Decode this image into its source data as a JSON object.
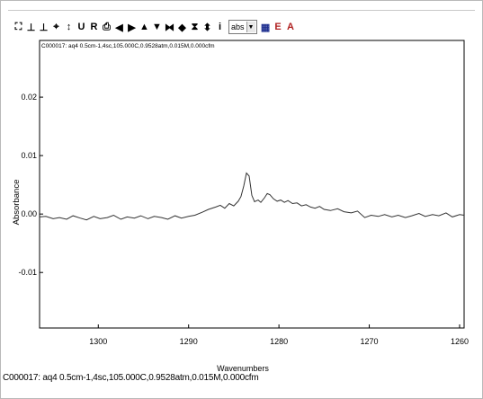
{
  "toolbar": {
    "items": [
      {
        "name": "zoom-full-icon",
        "glyph": "⛶"
      },
      {
        "name": "cursor-vertical-icon",
        "glyph": "⊥"
      },
      {
        "name": "cursor-vertical-pair-icon",
        "glyph": "⊥"
      },
      {
        "name": "crosshair-icon",
        "glyph": "⌖"
      },
      {
        "name": "vertical-expand-icon",
        "glyph": "↕"
      },
      {
        "name": "u-icon",
        "glyph": "U"
      },
      {
        "name": "r-icon",
        "glyph": "R"
      },
      {
        "name": "print-icon",
        "glyph": "⎙"
      },
      {
        "name": "scroll-left-icon",
        "glyph": "◀"
      },
      {
        "name": "scroll-right-icon",
        "glyph": "▶"
      },
      {
        "name": "scale-up-icon",
        "glyph": "▲"
      },
      {
        "name": "scale-down-icon",
        "glyph": "▼"
      },
      {
        "name": "expand-horizontal-icon",
        "glyph": "⧓"
      },
      {
        "name": "compress-horizontal-icon",
        "glyph": "◆"
      },
      {
        "name": "expand-vertical-icon",
        "glyph": "⧗"
      },
      {
        "name": "compress-vertical-icon",
        "glyph": "⬍"
      },
      {
        "name": "info-icon",
        "glyph": "i"
      }
    ],
    "select_value": "abs",
    "after_select": [
      {
        "name": "grid-icon",
        "glyph": "▦",
        "color": "#1d2e8f"
      },
      {
        "name": "e-icon",
        "glyph": "E",
        "color": "#b02020"
      },
      {
        "name": "a-icon",
        "glyph": "A",
        "color": "#b02020"
      }
    ]
  },
  "chart_data": {
    "type": "line",
    "title": "C000017: aq4 0.5cm-1,4sc,105.000C,0.9528atm,0.015M,0.000cfm",
    "xlabel": "Wavenumbers",
    "ylabel": "Absorbance",
    "x_reversed": true,
    "xlim": [
      1306.5,
      1259.5
    ],
    "ylim": [
      -0.0195,
      0.0297
    ],
    "xticks": [
      1300,
      1290,
      1280,
      1270,
      1260
    ],
    "xtick_labels": [
      "1300",
      "1290",
      "1280",
      "1270",
      "1260"
    ],
    "yticks": [
      0.02,
      0.01,
      0.0,
      -0.01
    ],
    "ytick_labels": [
      "0.02",
      "0.01",
      "0.00",
      "-0.01"
    ],
    "grid": false,
    "series": [
      {
        "color": "#333333",
        "x": [
          1306.5,
          1305.8,
          1305,
          1304.3,
          1303.5,
          1302.8,
          1302,
          1301.3,
          1300.5,
          1299.8,
          1299,
          1298.3,
          1297.5,
          1296.8,
          1296,
          1295.3,
          1294.5,
          1293.8,
          1293,
          1292.3,
          1291.5,
          1290.8,
          1290,
          1289.3,
          1288.5,
          1287.8,
          1287,
          1286.5,
          1286,
          1285.5,
          1285,
          1284.5,
          1284.2,
          1283.9,
          1283.6,
          1283.3,
          1283,
          1282.7,
          1282.3,
          1282,
          1281.6,
          1281.3,
          1281,
          1280.6,
          1280.2,
          1279.8,
          1279.4,
          1279,
          1278.5,
          1278,
          1277.5,
          1277,
          1276.5,
          1276,
          1275.5,
          1275,
          1274.3,
          1273.5,
          1272.8,
          1272,
          1271.3,
          1270.5,
          1269.8,
          1269,
          1268.3,
          1267.5,
          1266.8,
          1266,
          1265.3,
          1264.5,
          1263.8,
          1263,
          1262.3,
          1261.5,
          1260.8,
          1260,
          1259.5
        ],
        "y": [
          -0.0005,
          -0.0004,
          -0.0008,
          -0.0006,
          -0.0009,
          -0.0003,
          -0.0007,
          -0.001,
          -0.0004,
          -0.0008,
          -0.0006,
          -0.0002,
          -0.0009,
          -0.0005,
          -0.0007,
          -0.0003,
          -0.0008,
          -0.0004,
          -0.0006,
          -0.0009,
          -0.0003,
          -0.0007,
          -0.0004,
          -0.0002,
          0.0003,
          0.0008,
          0.0012,
          0.0015,
          0.001,
          0.0018,
          0.0014,
          0.0022,
          0.003,
          0.0048,
          0.007,
          0.0065,
          0.0032,
          0.0021,
          0.0024,
          0.002,
          0.0028,
          0.0035,
          0.0033,
          0.0026,
          0.0022,
          0.0024,
          0.002,
          0.0023,
          0.0018,
          0.0019,
          0.0014,
          0.0016,
          0.0012,
          0.001,
          0.0013,
          0.0008,
          0.0006,
          0.0009,
          0.0004,
          0.0002,
          0.0005,
          -0.0006,
          -0.0002,
          -0.0004,
          -0.0001,
          -0.0005,
          -0.0002,
          -0.0006,
          -0.0003,
          0.0001,
          -0.0004,
          -0.0001,
          -0.0003,
          0.0002,
          -0.0005,
          -0.0001,
          -0.0002
        ]
      }
    ]
  },
  "status": {
    "text": "C000017: aq4 0.5cm-1,4sc,105.000C,0.9528atm,0.015M,0.000cfm"
  }
}
